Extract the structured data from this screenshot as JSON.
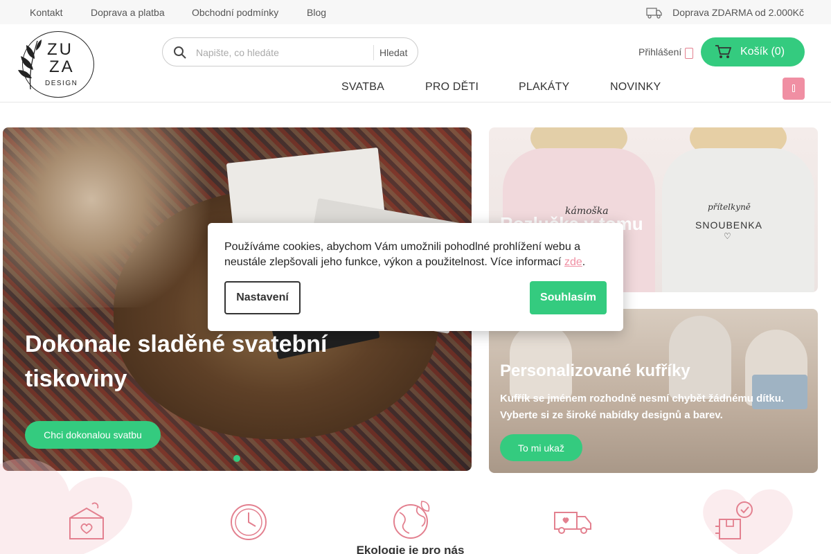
{
  "topbar": {
    "links": [
      "Kontakt",
      "Doprava a platba",
      "Obchodní podmínky",
      "Blog"
    ],
    "shipping_text": "Doprava ZDARMA od 2.000Kč"
  },
  "brand": {
    "line1": "ZU",
    "line2": "ZA",
    "line3": "DESIGN"
  },
  "search": {
    "placeholder": "Napište, co hledáte",
    "button_label": "Hledat"
  },
  "account": {
    "login_label": "Přihlášení"
  },
  "cart": {
    "label": "Košík (0)"
  },
  "nav": {
    "items": [
      "SVATBA",
      "PRO DĚTI",
      "PLAKÁTY",
      "NOVINKY"
    ]
  },
  "hero_main": {
    "title": "Dokonale sladěné svatební tiskoviny",
    "button_label": "Chci dokonalou svatbu"
  },
  "hero_top_right": {
    "title": "Rozlučka v tomu",
    "shirt_text_1": "kámoška",
    "shirt_text_2": "přítelkyně",
    "shirt_text_3": "SNOUBENKA",
    "shirt_text_4": "♡"
  },
  "hero_bottom_right": {
    "title": "Personalizované kufříky",
    "description": "Kufřík se jménem rozhodně nesmí chybět žádnému dítku. Vyberte si ze široké nabídky designů a barev.",
    "button_label": "To mi ukaž"
  },
  "cookie": {
    "text": "Používáme cookies, abychom Vám umožnili pohodlné prohlížení webu a neustále zlepšovali jeho funkce, výkon a použitelnost. Více informací ",
    "link_label": "zde",
    "text_end": ".",
    "settings_label": "Nastavení",
    "accept_label": "Souhlasím"
  },
  "features": {
    "visible_title": "Ekologie je pro nás",
    "icons": [
      "handmade-box-icon",
      "clock-icon",
      "eco-globe-icon",
      "delivery-truck-icon",
      "package-check-icon"
    ]
  },
  "colors": {
    "accent_green": "#34cb7f",
    "accent_pink": "#f08fa3",
    "icon_pink": "#e3808f"
  }
}
